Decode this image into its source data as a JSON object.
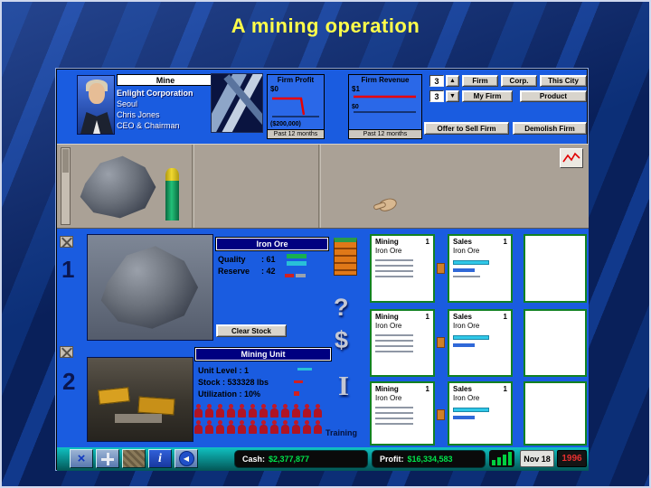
{
  "slide": {
    "title": "A mining operation"
  },
  "header": {
    "mine_label": "Mine",
    "corp_name": "Enlight Corporation",
    "city": "Seoul",
    "person_name": "Chris Jones",
    "person_role": "CEO & Chairman",
    "firm_profit": {
      "title": "Firm Profit",
      "value": "$0",
      "min_value": "($200,000)",
      "caption": "Past 12 months"
    },
    "firm_revenue": {
      "title": "Firm Revenue",
      "value": "$1",
      "min_value": "$0",
      "caption": "Past 12 months"
    },
    "floors_up_value": "3",
    "floors_down_value": "3",
    "buttons": {
      "firm": "Firm",
      "corp": "Corp.",
      "this_city": "This City",
      "my_firm": "My Firm",
      "product": "Product",
      "offer": "Offer to Sell Firm",
      "demolish": "Demolish Firm"
    }
  },
  "floors": {
    "floor1": "1",
    "floor2": "2"
  },
  "product_panel": {
    "title": "Iron Ore",
    "quality_label": "Quality",
    "quality_value": ": 61",
    "reserve_label": "Reserve",
    "reserve_value": ": 42",
    "clear_stock": "Clear Stock"
  },
  "mining_unit": {
    "title": "Mining Unit",
    "unit_level": "Unit Level : 1",
    "stock": "Stock : 533328 lbs",
    "utilization": "Utilization : 10%"
  },
  "side_column": {
    "training_label": "Training"
  },
  "units": {
    "rows": [
      {
        "mining": {
          "title": "Mining",
          "product": "Iron Ore",
          "level": "1"
        },
        "sales": {
          "title": "Sales",
          "product": "Iron Ore",
          "level": "1"
        }
      },
      {
        "mining": {
          "title": "Mining",
          "product": "Iron Ore",
          "level": "1"
        },
        "sales": {
          "title": "Sales",
          "product": "Iron Ore",
          "level": "1"
        }
      },
      {
        "mining": {
          "title": "Mining",
          "product": "Iron Ore",
          "level": "1"
        },
        "sales": {
          "title": "Sales",
          "product": "Iron Ore",
          "level": "1"
        }
      }
    ]
  },
  "statusbar": {
    "cash_label": "Cash:",
    "cash_value": "$2,377,877",
    "profit_label": "Profit:",
    "profit_value": "$16,334,583",
    "date": "Nov 18",
    "year": "1996"
  },
  "icons": {
    "spinner_up": "▲",
    "spinner_down": "▼",
    "close": "×",
    "info": "i",
    "back": "◀",
    "question": "?",
    "dollar": "$",
    "pillar": "I"
  },
  "colors": {
    "game_blue": "#1a5ce0",
    "navy_titlebar": "#000080",
    "cash_green": "#00e44c",
    "year_red": "#e83030",
    "title_yellow": "#ffff4a"
  }
}
